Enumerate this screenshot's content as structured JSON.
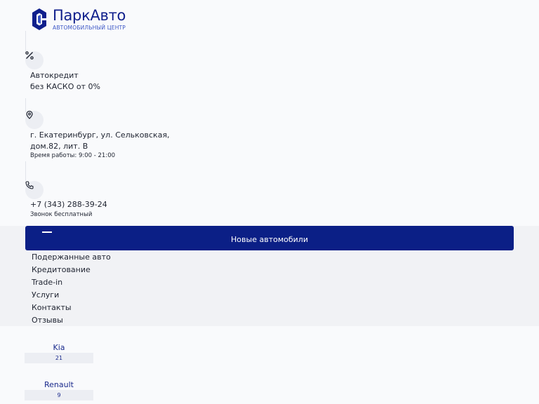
{
  "logo": {
    "title": "ПаркАвто",
    "subtitle": "АВТОМОБИЛЬНЫЙ ЦЕНТР"
  },
  "info": {
    "credit": {
      "icon": "percent-icon",
      "line1": "Автокредит",
      "line2": "без КАСКО от 0%"
    },
    "address": {
      "icon": "location-pin-icon",
      "line1": "г. Екатеринбург, ул. Сельковская,",
      "line2": "дом.82, лит. В",
      "hours": "Время работы: 9:00 - 21:00"
    },
    "phone": {
      "icon": "phone-icon",
      "number": "+7 (343) 288-39-24",
      "note": "Звонок бесплатный"
    }
  },
  "nav": {
    "primary": "Новые автомобили",
    "items": [
      "Подержанные авто",
      "Кредитование",
      "Trade-in",
      "Услуги",
      "Контакты",
      "Отзывы"
    ]
  },
  "brands": [
    {
      "name": "Kia",
      "count": "21"
    },
    {
      "name": "Renault",
      "count": "9"
    }
  ],
  "colors": {
    "brand": "#0b1f86",
    "background": "#f9fafc",
    "nav_background": "#f1f2f5"
  }
}
